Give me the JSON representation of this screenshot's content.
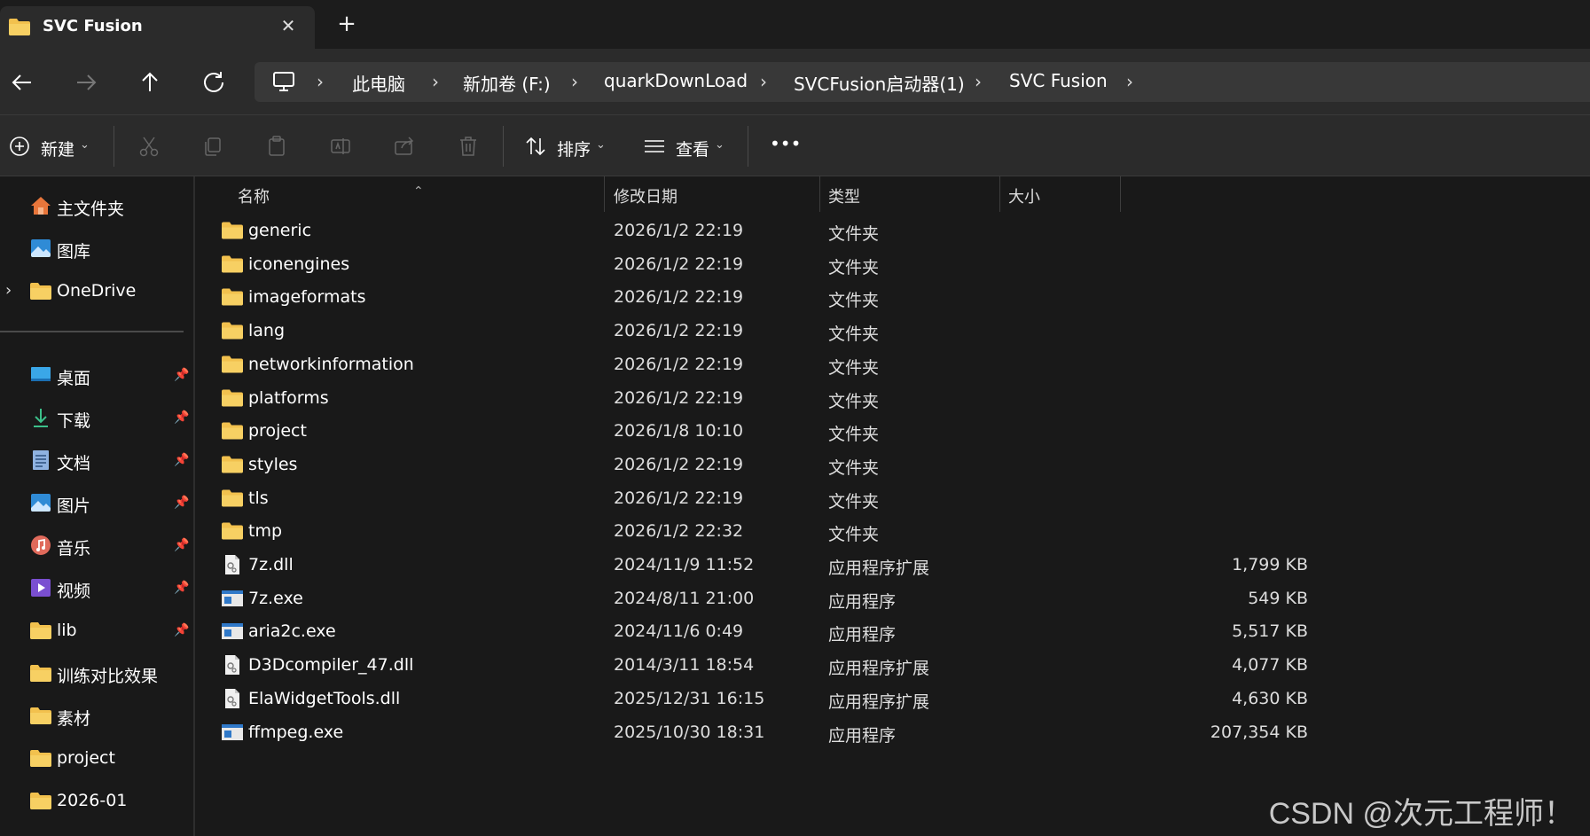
{
  "window": {
    "tab_title": "SVC Fusion",
    "new_tab_symbol": "+",
    "close_symbol": "✕"
  },
  "address_bar": {
    "segments": [
      "此电脑",
      "新加卷 (F:)",
      "quarkDownLoad",
      "SVCFusion启动器(1)",
      "SVC Fusion"
    ]
  },
  "toolbar": {
    "new_label": "新建",
    "sort_label": "排序",
    "view_label": "查看",
    "more_label": "•••"
  },
  "sidebar": {
    "top_items": [
      {
        "label": "主文件夹",
        "icon": "home-icon"
      },
      {
        "label": "图库",
        "icon": "gallery-icon"
      },
      {
        "label": "OneDrive",
        "icon": "folder-icon"
      }
    ],
    "pinned_items": [
      {
        "label": "桌面",
        "icon": "desktop-icon",
        "pinned": true
      },
      {
        "label": "下载",
        "icon": "download-icon",
        "pinned": true
      },
      {
        "label": "文档",
        "icon": "document-icon",
        "pinned": true
      },
      {
        "label": "图片",
        "icon": "pictures-icon",
        "pinned": true
      },
      {
        "label": "音乐",
        "icon": "music-icon",
        "pinned": true
      },
      {
        "label": "视频",
        "icon": "video-icon",
        "pinned": true
      },
      {
        "label": "lib",
        "icon": "folder-icon",
        "pinned": true
      },
      {
        "label": "训练对比效果",
        "icon": "folder-icon",
        "pinned": false
      },
      {
        "label": "素材",
        "icon": "folder-icon",
        "pinned": false
      },
      {
        "label": "project",
        "icon": "folder-icon",
        "pinned": false
      },
      {
        "label": "2026-01",
        "icon": "folder-icon",
        "pinned": false
      }
    ]
  },
  "columns": {
    "name": "名称",
    "modified": "修改日期",
    "type": "类型",
    "size": "大小"
  },
  "files": [
    {
      "name": "generic",
      "date": "2026/1/2 22:19",
      "type": "文件夹",
      "size": "",
      "icon": "folder-icon"
    },
    {
      "name": "iconengines",
      "date": "2026/1/2 22:19",
      "type": "文件夹",
      "size": "",
      "icon": "folder-icon"
    },
    {
      "name": "imageformats",
      "date": "2026/1/2 22:19",
      "type": "文件夹",
      "size": "",
      "icon": "folder-icon"
    },
    {
      "name": "lang",
      "date": "2026/1/2 22:19",
      "type": "文件夹",
      "size": "",
      "icon": "folder-icon"
    },
    {
      "name": "networkinformation",
      "date": "2026/1/2 22:19",
      "type": "文件夹",
      "size": "",
      "icon": "folder-icon"
    },
    {
      "name": "platforms",
      "date": "2026/1/2 22:19",
      "type": "文件夹",
      "size": "",
      "icon": "folder-icon"
    },
    {
      "name": "project",
      "date": "2026/1/8 10:10",
      "type": "文件夹",
      "size": "",
      "icon": "folder-icon"
    },
    {
      "name": "styles",
      "date": "2026/1/2 22:19",
      "type": "文件夹",
      "size": "",
      "icon": "folder-icon"
    },
    {
      "name": "tls",
      "date": "2026/1/2 22:19",
      "type": "文件夹",
      "size": "",
      "icon": "folder-icon"
    },
    {
      "name": "tmp",
      "date": "2026/1/2 22:32",
      "type": "文件夹",
      "size": "",
      "icon": "folder-icon"
    },
    {
      "name": "7z.dll",
      "date": "2024/11/9 11:52",
      "type": "应用程序扩展",
      "size": "1,799 KB",
      "icon": "dll-icon"
    },
    {
      "name": "7z.exe",
      "date": "2024/8/11 21:00",
      "type": "应用程序",
      "size": "549 KB",
      "icon": "exe-icon"
    },
    {
      "name": "aria2c.exe",
      "date": "2024/11/6 0:49",
      "type": "应用程序",
      "size": "5,517 KB",
      "icon": "exe-icon"
    },
    {
      "name": "D3Dcompiler_47.dll",
      "date": "2014/3/11 18:54",
      "type": "应用程序扩展",
      "size": "4,077 KB",
      "icon": "dll-icon"
    },
    {
      "name": "ElaWidgetTools.dll",
      "date": "2025/12/31 16:15",
      "type": "应用程序扩展",
      "size": "4,630 KB",
      "icon": "dll-icon"
    },
    {
      "name": "ffmpeg.exe",
      "date": "2025/10/30 18:31",
      "type": "应用程序",
      "size": "207,354 KB",
      "icon": "exe-icon"
    }
  ],
  "watermark": "CSDN @次元工程师！"
}
